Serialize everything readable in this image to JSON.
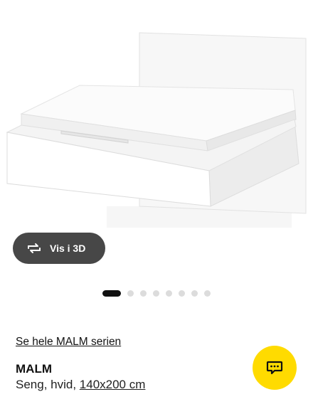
{
  "header": {
    "top_icon": "chevron-down-icon"
  },
  "product_image": {
    "alt": "bed-image"
  },
  "view_3d": {
    "label": "Vis i 3D",
    "icon": "rotate-3d-icon"
  },
  "carousel": {
    "total": 8,
    "active": 1
  },
  "series_link": {
    "label": "Se hele MALM serien"
  },
  "product": {
    "name": "MALM",
    "desc_prefix": "Seng, hvid, ",
    "size": "140x200 cm"
  },
  "chat": {
    "icon": "chat-bubble-icon"
  },
  "colors": {
    "chat_bg": "#ffdb00",
    "btn_3d_bg": "#474747"
  }
}
